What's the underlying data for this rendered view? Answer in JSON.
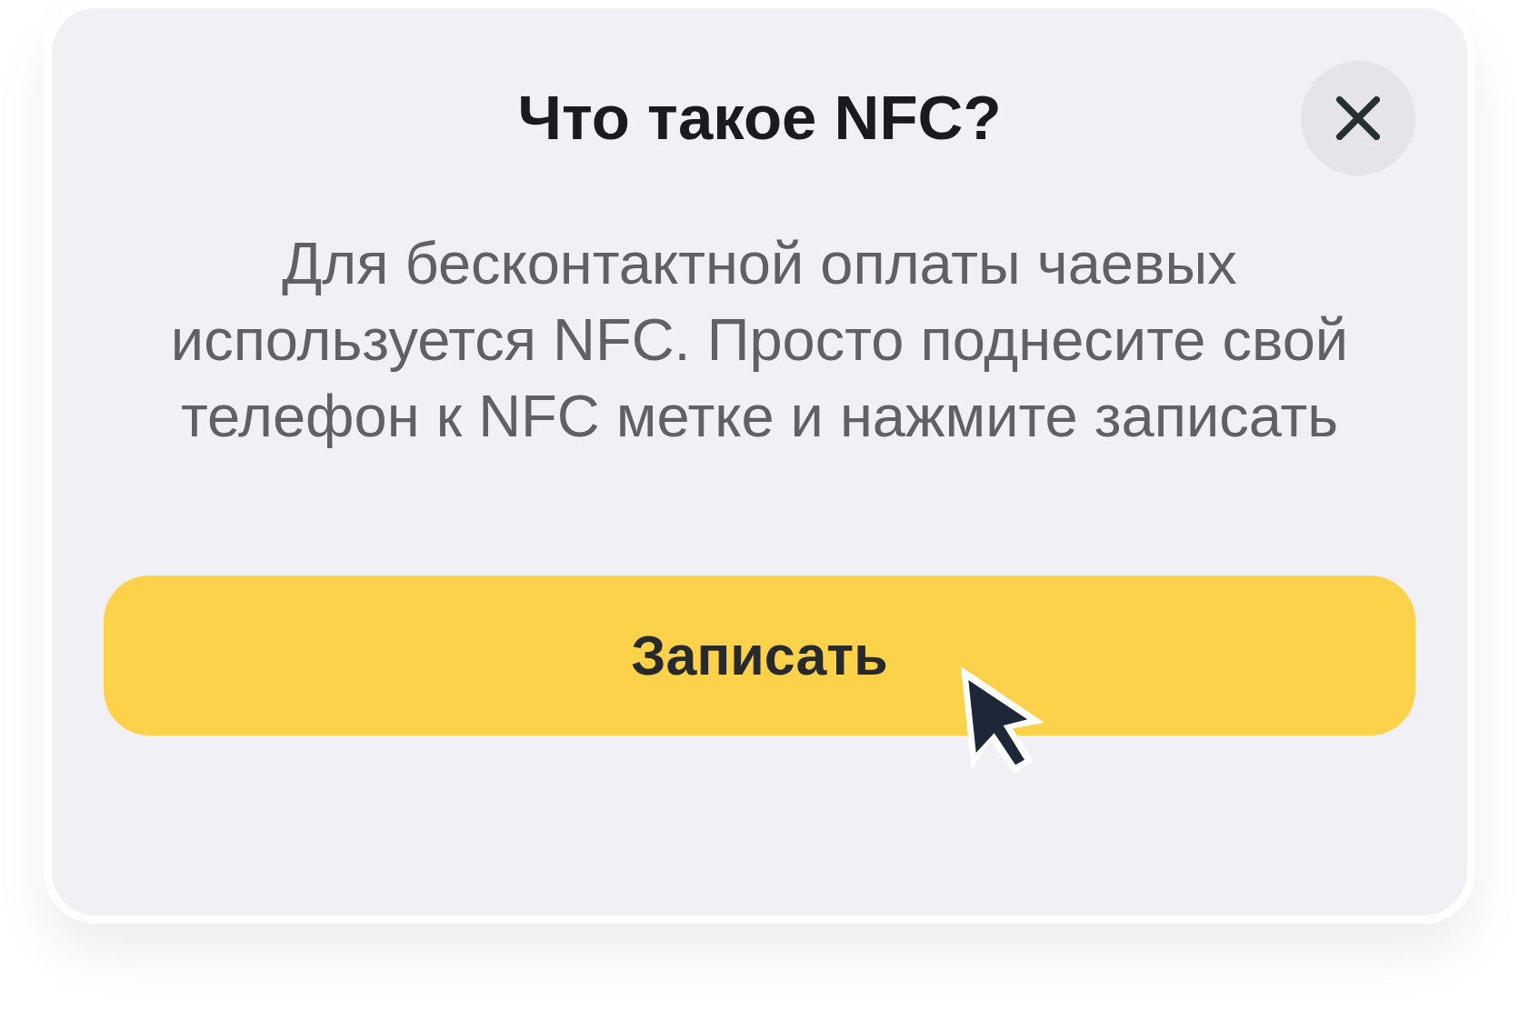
{
  "dialog": {
    "title": "Что такое NFC?",
    "description": "Для бесконтактной оплаты чаевых используется NFC. Просто поднесите свой телефон к NFC метке и нажмите записать",
    "primary_button": {
      "label": "Записать"
    }
  }
}
